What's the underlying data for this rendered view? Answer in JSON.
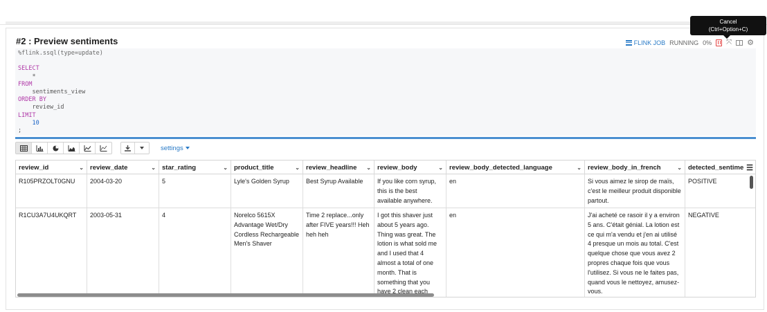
{
  "paragraph": {
    "title": "#2 : Preview sentiments",
    "status": {
      "job_link": "FLINK JOB",
      "state": "RUNNING",
      "progress": "0%"
    },
    "tooltip": {
      "line1": "Cancel",
      "line2": "(Ctrl+Option+C)"
    },
    "icons": [
      "cancel-icon",
      "expand-icon",
      "book-icon",
      "gear-icon"
    ],
    "annotation_color": "#f0230f"
  },
  "editor": {
    "lines": [
      {
        "text": "%flink.ssql(type=update)",
        "style": "muted"
      },
      {
        "text": "",
        "style": "plain"
      },
      {
        "text": "SELECT",
        "style": "kw"
      },
      {
        "text": "    *",
        "style": "plain"
      },
      {
        "text": "FROM",
        "style": "kw"
      },
      {
        "text": "    sentiments_view",
        "style": "plain"
      },
      {
        "text": "ORDER BY",
        "style": "kw"
      },
      {
        "text": "    review_id",
        "style": "plain"
      },
      {
        "text": "LIMIT",
        "style": "kw"
      },
      {
        "text": "    10",
        "style": "num"
      },
      {
        "text": ";",
        "style": "plain"
      }
    ]
  },
  "toolbar": {
    "view_buttons": [
      "table-icon",
      "bar-chart-icon",
      "pie-chart-icon",
      "area-chart-icon",
      "line-chart-icon",
      "scatter-chart-icon"
    ],
    "settings_label": "settings"
  },
  "table": {
    "columns": [
      {
        "label": "review_id",
        "w": 103
      },
      {
        "label": "review_date",
        "w": 104
      },
      {
        "label": "star_rating",
        "w": 104
      },
      {
        "label": "product_title",
        "w": 104
      },
      {
        "label": "review_headline",
        "w": 103
      },
      {
        "label": "review_body",
        "w": 104
      },
      {
        "label": "review_body_detected_language",
        "w": 200
      },
      {
        "label": "review_body_in_french",
        "w": 145
      },
      {
        "label": "detected_sentime",
        "w": 103
      }
    ],
    "rows": [
      [
        "R105PRZOLT0GNU",
        "2004-03-20",
        "5",
        "Lyle's Golden Syrup",
        "Best Syrup Available",
        "If you like corn syrup, this is the best available anywhere.",
        "en",
        "Si vous aimez le sirop de maïs, c'est le meilleur produit disponible partout.",
        "POSITIVE"
      ],
      [
        "R1CU3A7U4UKQRT",
        "2003-05-31",
        "4",
        "Norelco 5615X Advantage Wet/Dry Cordless Rechargeable Men's Shaver",
        "Time 2 replace...only after FIVE years!!! Heh heh heh",
        "I got this shaver just about 5 years ago. Thing was great.  The lotion is what sold me and I used that 4 almost a total of one month.  That is something that you have 2 clean each",
        "en",
        "J'ai acheté ce rasoir il y a environ 5 ans. C'était génial. La lotion est ce qui m'a vendu et j'en ai utilisé 4 presque un mois au total. C'est quelque chose que vous avez 2 propres chaque fois que vous l'utilisez. Si vous ne le faites pas, quand vous le nettoyez, amusez-vous.",
        "NEGATIVE"
      ]
    ]
  }
}
